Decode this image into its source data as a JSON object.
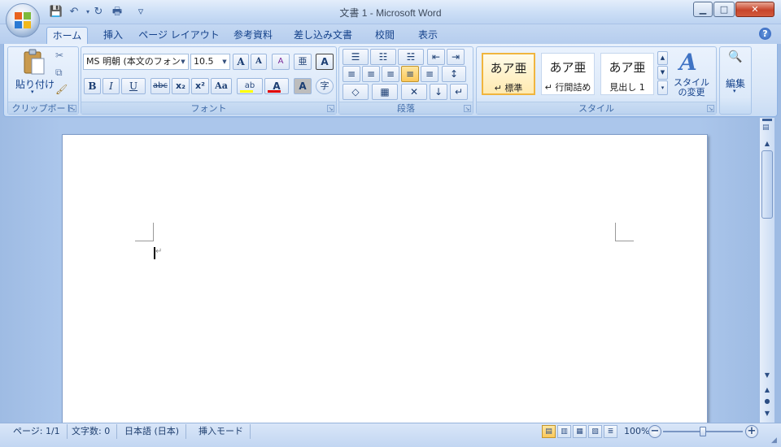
{
  "window": {
    "title": "文書 1 - Microsoft Word",
    "minimize": "▁",
    "maximize": "□",
    "close": "✕"
  },
  "quick_access": {
    "save": "💾",
    "undo": "↶",
    "redo": "↻",
    "print": "🖶",
    "customize": "▿"
  },
  "tabs": [
    {
      "label": "ホーム",
      "active": true
    },
    {
      "label": "挿入"
    },
    {
      "label": "ページ レイアウト"
    },
    {
      "label": "参考資料"
    },
    {
      "label": "差し込み文書"
    },
    {
      "label": "校閲"
    },
    {
      "label": "表示"
    }
  ],
  "help": "?",
  "groups": {
    "clipboard": {
      "label": "クリップボード",
      "paste": "貼り付け",
      "cut": "✂",
      "copy": "⧉",
      "format_painter": "🖌"
    },
    "font": {
      "label": "フォント",
      "font_name": "MS 明朝 (本文のフォン",
      "font_size": "10.5",
      "grow": "A",
      "shrink": "A",
      "clear": "A",
      "phonetic": "亜",
      "char_border": "A",
      "bold": "B",
      "italic": "I",
      "underline": "U",
      "strike": "abc",
      "subscript": "x₂",
      "superscript": "x²",
      "change_case": "Aa",
      "highlight": "ab",
      "font_color": "A",
      "char_shading": "A",
      "enclose": "字"
    },
    "paragraph": {
      "label": "段落",
      "bullets": "☰",
      "numbering": "☷",
      "multilevel": "☵",
      "decrease_indent": "⇤",
      "increase_indent": "⇥",
      "align_left": "≡",
      "align_center": "≡",
      "align_right": "≡",
      "justify": "≡",
      "distribute": "≡",
      "line_spacing": "↕",
      "shading": "◇",
      "borders": "▦",
      "asian_layout": "✕",
      "sort": "↓",
      "show_marks": "↵"
    },
    "styles": {
      "label": "スタイル",
      "items": [
        {
          "preview": "あア亜",
          "name": "↵ 標準",
          "selected": true
        },
        {
          "preview": "あア亜",
          "name": "↵ 行間詰め"
        },
        {
          "preview": "あア亜",
          "name": "見出し 1"
        }
      ],
      "change_styles": "スタイルの変更"
    },
    "editing": {
      "label": "編集",
      "icon": "🔍"
    }
  },
  "document": {
    "paragraph_mark": "↵"
  },
  "status": {
    "page": "ページ: 1/1",
    "word_count": "文字数: 0",
    "language": "日本語 (日本)",
    "mode": "挿入モード",
    "zoom": "100%",
    "zoom_level": 0.5,
    "zoom_out": "−",
    "zoom_in": "+"
  },
  "views": [
    "▤",
    "▥",
    "▦",
    "▧",
    "≣"
  ],
  "colors": {
    "highlight": "#ffff00",
    "font_color": "#e00000"
  }
}
